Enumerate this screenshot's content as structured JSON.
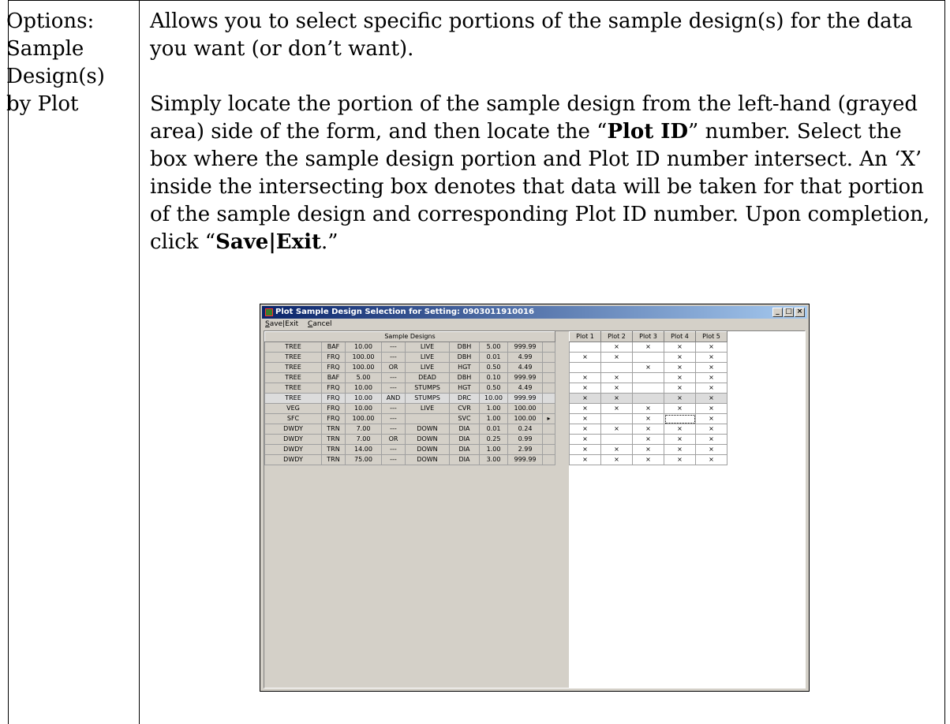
{
  "left_label": [
    "Options:",
    "Sample",
    "Design(s)",
    "by Plot"
  ],
  "para1": "Allows you to select specific portions of the sample design(s) for the data you want (or don’t want).",
  "para2": {
    "t1": "Simply locate the portion of the sample design from the left-hand (grayed area) side of the form, and then locate the “",
    "b1": "Plot ID",
    "t2": "” number. Select the box where the sample design portion and Plot ID number intersect.  An ‘X’ inside the intersecting box denotes that data will be taken for that portion of the sample design and corresponding Plot ID number.  Upon completion, click “",
    "b2": "Save|Exit",
    "t3": ".”"
  },
  "window": {
    "title": "Plot Sample Design Selection for Setting: 0903011910016",
    "menu": [
      {
        "underline": "S",
        "rest": "ave|Exit"
      },
      {
        "underline": "C",
        "rest": "ancel"
      }
    ],
    "left_header": "Sample Designs",
    "plot_headers": [
      "Plot  1",
      "Plot  2",
      "Plot  3",
      "Plot  4",
      "Plot  5"
    ],
    "rows": [
      {
        "cells": [
          "TREE",
          "BAF",
          "10.00",
          "---",
          "LIVE",
          "DBH",
          "5.00",
          "999.99"
        ],
        "marker": "",
        "plots": [
          "",
          "×",
          "×",
          "×",
          "×"
        ]
      },
      {
        "cells": [
          "TREE",
          "FRQ",
          "100.00",
          "---",
          "LIVE",
          "DBH",
          "0.01",
          "4.99"
        ],
        "marker": "",
        "plots": [
          "×",
          "×",
          "",
          "×",
          "×"
        ]
      },
      {
        "cells": [
          "TREE",
          "FRQ",
          "100.00",
          "OR",
          "LIVE",
          "HGT",
          "0.50",
          "4.49"
        ],
        "marker": "",
        "plots": [
          "",
          "",
          "×",
          "×",
          "×"
        ]
      },
      {
        "cells": [
          "TREE",
          "BAF",
          "5.00",
          "---",
          "DEAD",
          "DBH",
          "0.10",
          "999.99"
        ],
        "marker": "",
        "plots": [
          "×",
          "×",
          "",
          "×",
          "×"
        ]
      },
      {
        "cells": [
          "TREE",
          "FRQ",
          "10.00",
          "---",
          "STUMPS",
          "HGT",
          "0.50",
          "4.49"
        ],
        "marker": "",
        "plots": [
          "×",
          "×",
          "",
          "×",
          "×"
        ]
      },
      {
        "cells": [
          "TREE",
          "FRQ",
          "10.00",
          "AND",
          "STUMPS",
          "DRC",
          "10.00",
          "999.99"
        ],
        "marker": "",
        "plots": [
          "×",
          "×",
          "",
          "×",
          "×"
        ]
      },
      {
        "cells": [
          "VEG",
          "FRQ",
          "10.00",
          "---",
          "LIVE",
          "CVR",
          "1.00",
          "100.00"
        ],
        "marker": "",
        "plots": [
          "×",
          "×",
          "×",
          "×",
          "×"
        ]
      },
      {
        "cells": [
          "SFC",
          "FRQ",
          "100.00",
          "---",
          "",
          "SVC",
          "1.00",
          "100.00"
        ],
        "marker": "▸",
        "plots": [
          "×",
          "",
          "×",
          "",
          "×"
        ]
      },
      {
        "cells": [
          "DWDY",
          "TRN",
          "7.00",
          "---",
          "DOWN",
          "DIA",
          "0.01",
          "0.24"
        ],
        "marker": "",
        "plots": [
          "×",
          "×",
          "×",
          "×",
          "×"
        ]
      },
      {
        "cells": [
          "DWDY",
          "TRN",
          "7.00",
          "OR",
          "DOWN",
          "DIA",
          "0.25",
          "0.99"
        ],
        "marker": "",
        "plots": [
          "×",
          "",
          "×",
          "×",
          "×"
        ]
      },
      {
        "cells": [
          "DWDY",
          "TRN",
          "14.00",
          "---",
          "DOWN",
          "DIA",
          "1.00",
          "2.99"
        ],
        "marker": "",
        "plots": [
          "×",
          "×",
          "×",
          "×",
          "×"
        ]
      },
      {
        "cells": [
          "DWDY",
          "TRN",
          "75.00",
          "---",
          "DOWN",
          "DIA",
          "3.00",
          "999.99"
        ],
        "marker": "",
        "plots": [
          "×",
          "×",
          "×",
          "×",
          "×"
        ]
      }
    ]
  }
}
